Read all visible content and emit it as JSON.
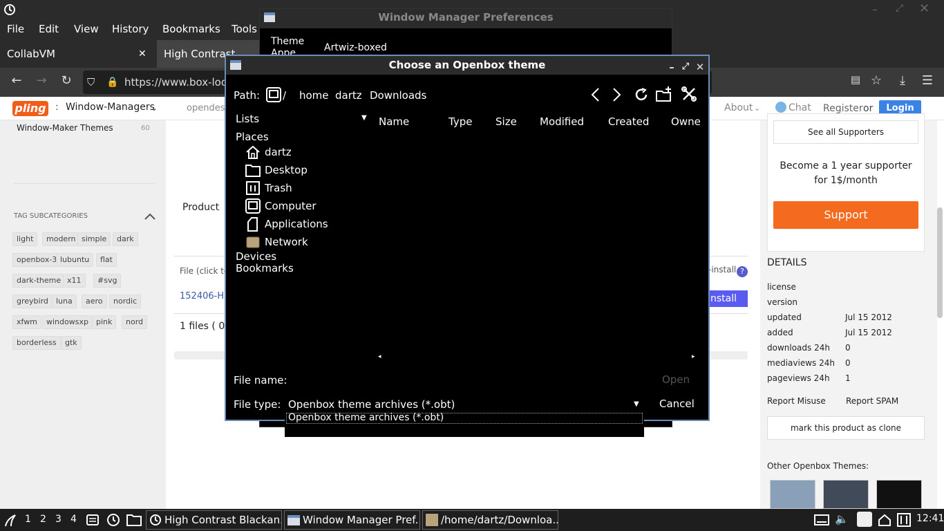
{
  "browser": {
    "menu": [
      "File",
      "Edit",
      "View",
      "History",
      "Bookmarks",
      "Tools"
    ],
    "tabs": [
      {
        "label": "CollabVM"
      },
      {
        "label": "High Contrast Black"
      }
    ],
    "url": "https://www.box-loo"
  },
  "site": {
    "logo": "pling",
    "category": "Window-Managers",
    "nav_partial": "opendes",
    "about": "About",
    "chat": "Chat",
    "register": "Register",
    "or": "or",
    "login": "Login",
    "sidebar_item": "Window-Maker Themes",
    "sidebar_count": "60",
    "tag_heading": "TAG SUBCATEGORIES",
    "tags": [
      "light",
      "modern",
      "simple",
      "dark",
      "openbox-3",
      "lubuntu",
      "flat",
      "dark-theme",
      "x11",
      "#svg",
      "greybird",
      "luna",
      "aero",
      "nordic",
      "xfwm",
      "windowsxp",
      "pink",
      "nord",
      "borderless",
      "gtk"
    ],
    "product_label": "Product",
    "file_click": "File (click to",
    "install_partial": "-install",
    "file_link": "152406-H",
    "install_btn": "nstall",
    "files_count": "1 files ( 0",
    "see_all": "See all Supporters",
    "supporter_text": "Become a 1 year supporter for 1$/month",
    "support_btn": "Support",
    "details_heading": "DETAILS",
    "details": [
      {
        "label": "license",
        "value": ""
      },
      {
        "label": "version",
        "value": ""
      },
      {
        "label": "updated",
        "value": "Jul 15 2012"
      },
      {
        "label": "added",
        "value": "Jul 15 2012"
      },
      {
        "label": "downloads 24h",
        "value": "0"
      },
      {
        "label": "mediaviews 24h",
        "value": "0"
      },
      {
        "label": "pageviews 24h",
        "value": "1"
      }
    ],
    "report_misuse": "Report Misuse",
    "report_spam": "Report SPAM",
    "clone_btn": "mark this product as clone",
    "other_themes": "Other Openbox Themes:"
  },
  "wmprefs": {
    "title": "Window Manager Preferences",
    "tab_theme": "Theme",
    "tab_appe": "Appe",
    "theme_value": "Artwiz-boxed"
  },
  "dialog": {
    "title": "Choose an Openbox theme",
    "path_label": "Path:",
    "path_root": "/",
    "crumbs": [
      "home",
      "dartz",
      "Downloads"
    ],
    "lists": "Lists",
    "places": "Places",
    "place_items": [
      "dartz",
      "Desktop",
      "Trash",
      "Computer",
      "Applications",
      "Network"
    ],
    "devices": "Devices",
    "bookmarks": "Bookmarks",
    "columns": [
      "Name",
      "Type",
      "Size",
      "Modified",
      "Created",
      "Owner"
    ],
    "file_name_label": "File name:",
    "file_name_value": "",
    "open_btn": "Open",
    "file_type_label": "File type:",
    "file_type_value": "Openbox theme archives (*.obt)",
    "cancel_btn": "Cancel",
    "dropdown_option": "Openbox theme archives (*.obt)"
  },
  "taskbar": {
    "workspaces": [
      "1",
      "2",
      "3",
      "4"
    ],
    "tasks": [
      "High Contrast Blackan...",
      "Window Manager Pref...",
      "/home/dartz/Downloa..."
    ],
    "clock": "12:41"
  }
}
